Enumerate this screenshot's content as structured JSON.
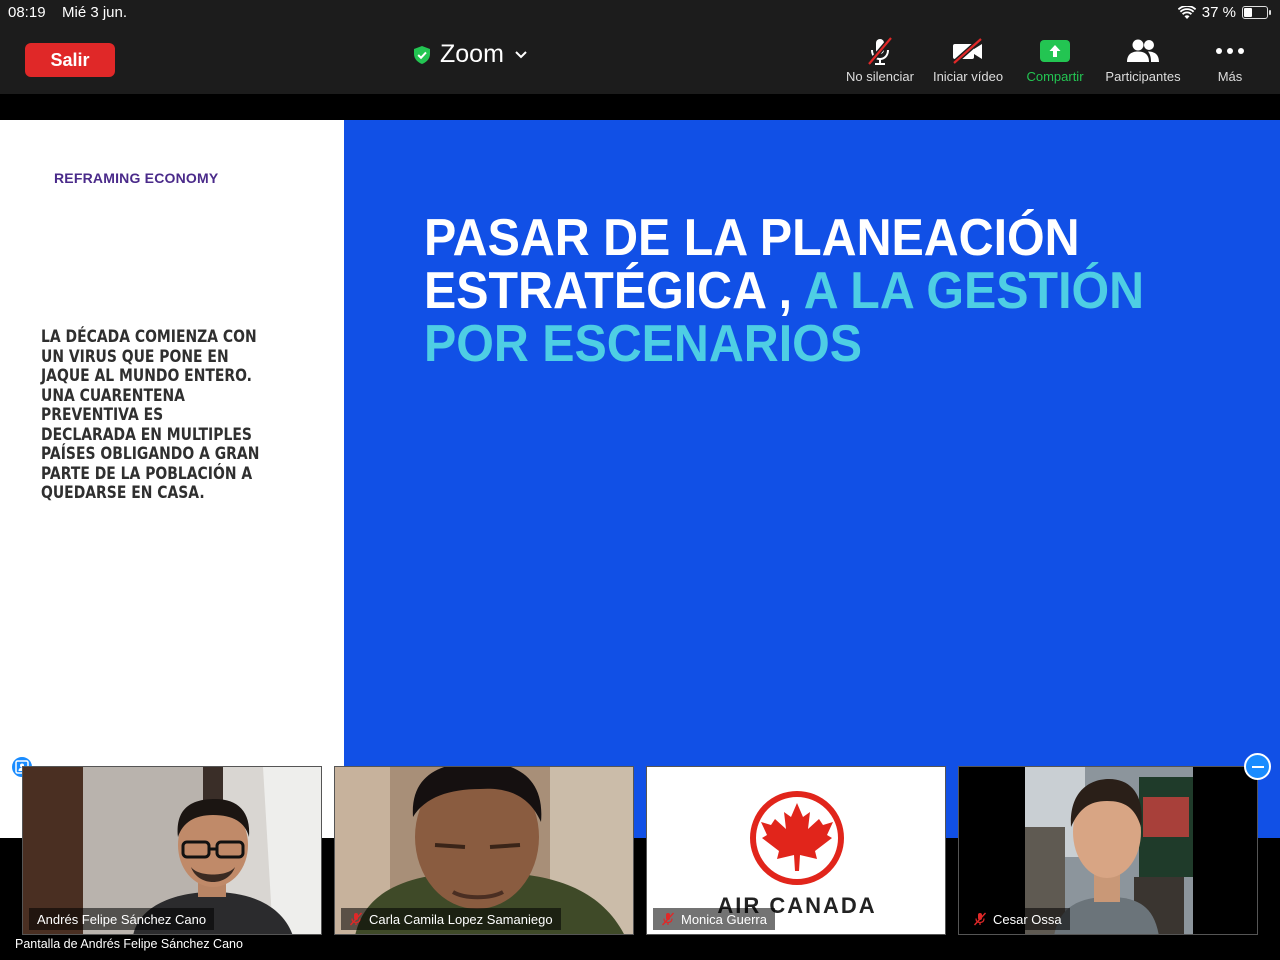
{
  "status_bar": {
    "time": "08:19",
    "date": "Mié 3 jun.",
    "battery_text": "37 %",
    "battery_level": 0.37
  },
  "toolbar": {
    "leave_label": "Salir",
    "meeting_title": "Zoom",
    "items": [
      {
        "label": "No silenciar",
        "icon": "microphone-muted-icon"
      },
      {
        "label": "Iniciar vídeo",
        "icon": "video-off-icon"
      },
      {
        "label": "Compartir",
        "icon": "share-screen-icon"
      },
      {
        "label": "Participantes",
        "icon": "participants-icon"
      },
      {
        "label": "Más",
        "icon": "more-icon"
      }
    ],
    "colors": {
      "leave": "#e02828",
      "share": "#23c552",
      "secure": "#23c552"
    }
  },
  "slide": {
    "brand": "REFRAMING ECONOMY",
    "left_lines": [
      "LA DÉCADA COMIENZA CON",
      "UN VIRUS QUE PONE EN",
      "JAQUE AL MUNDO ENTERO.",
      "UNA CUARENTENA",
      "PREVENTIVA ES",
      "DECLARADA EN MULTIPLES",
      "PAÍSES OBLIGANDO A GRAN",
      "PARTE DE LA POBLACIÓN A",
      "QUEDARSE EN CASA."
    ],
    "headline_line1": "PASAR DE LA PLANEACIÓN",
    "headline_line2_white": "ESTRATÉGICA , ",
    "headline_line2_cyan": "A LA GESTIÓN",
    "headline_line3": "POR ESCENARIOS",
    "colors": {
      "background": "#1150e6",
      "accent": "#4ecee4"
    }
  },
  "participants": [
    {
      "name": "Andrés Felipe Sánchez Cano",
      "muted": false
    },
    {
      "name": "Carla Camila Lopez Samaniego",
      "muted": true
    },
    {
      "name": "Monica Guerra",
      "muted": true,
      "logo_text": "AIR CANADA"
    },
    {
      "name": "Cesar Ossa",
      "muted": true
    }
  ],
  "share_caption": "Pantalla de Andrés Felipe Sánchez Cano"
}
